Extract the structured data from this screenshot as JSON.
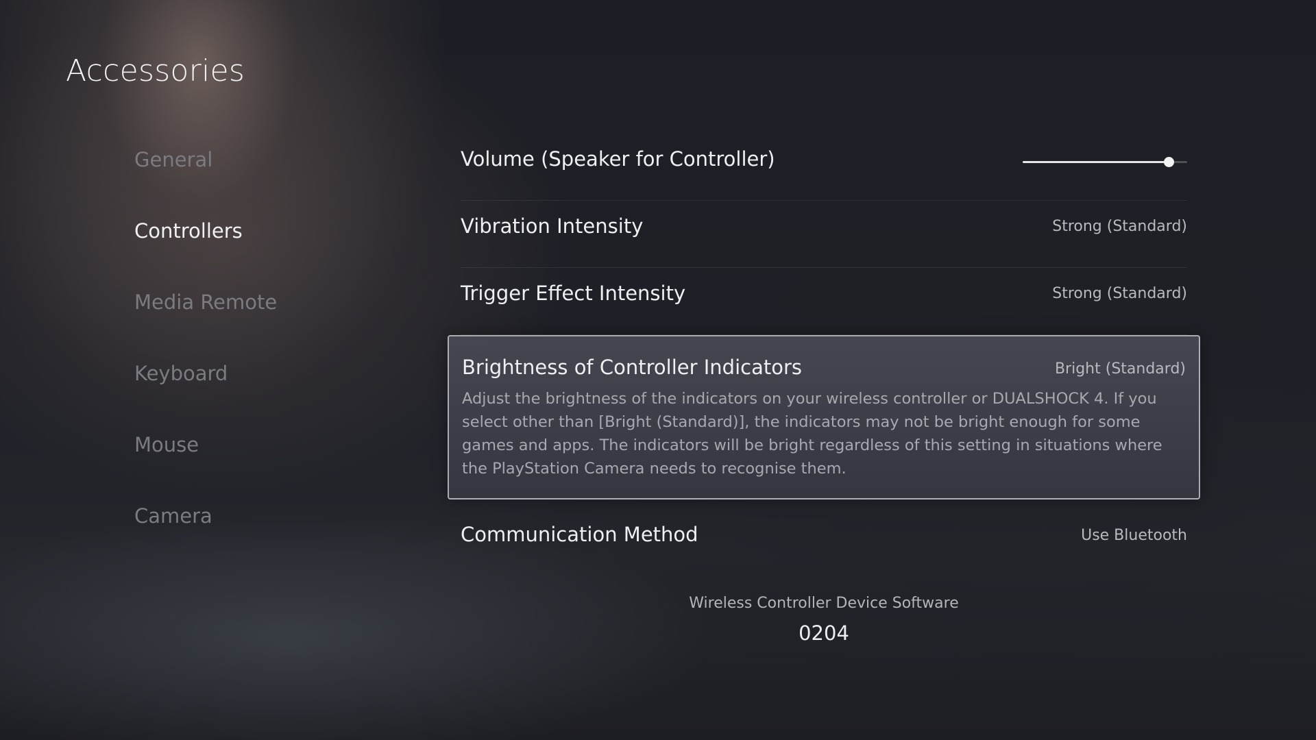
{
  "header": {
    "title": "Accessories"
  },
  "sidebar": {
    "items": [
      {
        "label": "General"
      },
      {
        "label": "Controllers"
      },
      {
        "label": "Media Remote"
      },
      {
        "label": "Keyboard"
      },
      {
        "label": "Mouse"
      },
      {
        "label": "Camera"
      }
    ],
    "selected": "Controllers"
  },
  "settings": {
    "volume": {
      "label": "Volume (Speaker for Controller)",
      "level_fraction": 0.89
    },
    "vibration": {
      "label": "Vibration Intensity",
      "value": "Strong (Standard)"
    },
    "trigger": {
      "label": "Trigger Effect Intensity",
      "value": "Strong (Standard)"
    },
    "brightness": {
      "label": "Brightness of Controller Indicators",
      "value": "Bright (Standard)",
      "description": "Adjust the brightness of the indicators on your wireless controller or DUALSHOCK 4. If you select other than [Bright (Standard)], the indicators may not be bright enough for some games and apps. The indicators will be bright regardless of this setting in situations where the PlayStation Camera needs to recognise them."
    },
    "communication": {
      "label": "Communication Method",
      "value": "Use Bluetooth"
    }
  },
  "footer": {
    "label": "Wireless Controller Device Software",
    "version": "0204"
  }
}
